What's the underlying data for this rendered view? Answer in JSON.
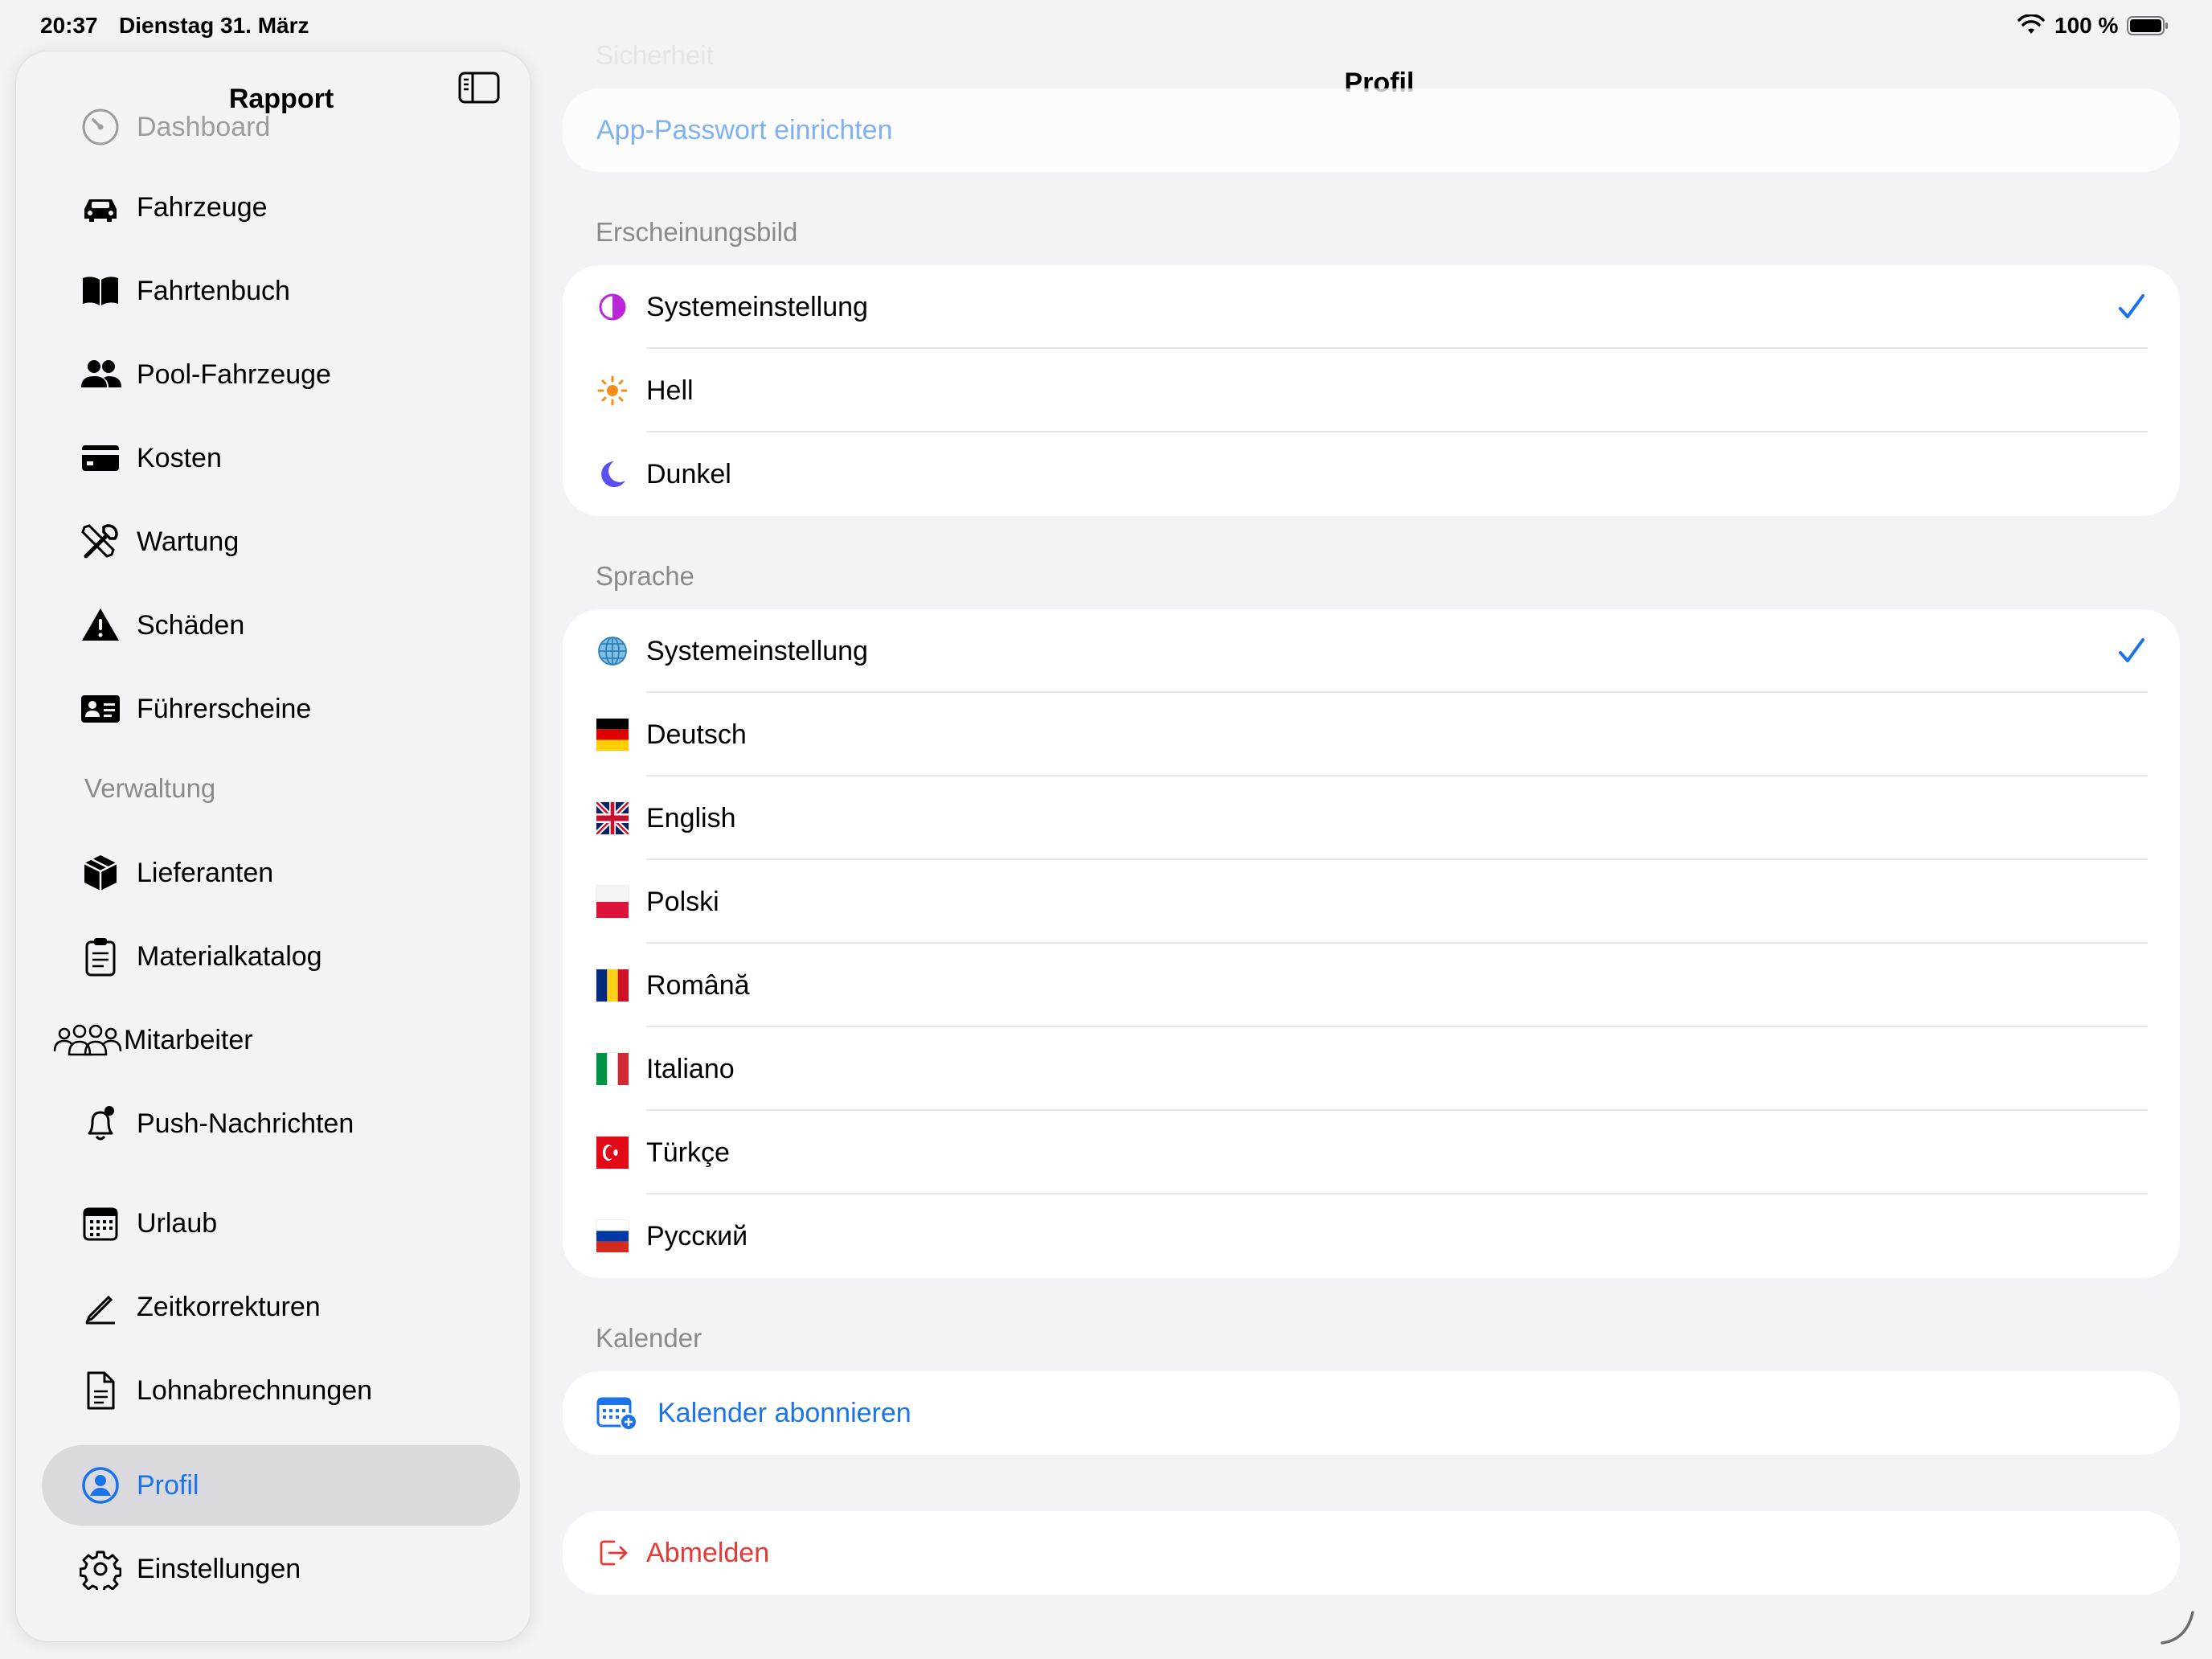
{
  "status_bar": {
    "time": "20:37",
    "date": "Dienstag 31. März",
    "battery": "100 %"
  },
  "sidebar": {
    "title": "Rapport",
    "items": [
      {
        "label": "Dashboard",
        "icon": "gauge-icon"
      },
      {
        "label": "Fahrzeuge",
        "icon": "car-icon"
      },
      {
        "label": "Fahrtenbuch",
        "icon": "book-icon"
      },
      {
        "label": "Pool-Fahrzeuge",
        "icon": "people-icon"
      },
      {
        "label": "Kosten",
        "icon": "credit-card-icon"
      },
      {
        "label": "Wartung",
        "icon": "wrench-screwdriver-icon"
      },
      {
        "label": "Schäden",
        "icon": "warning-icon"
      },
      {
        "label": "Führerscheine",
        "icon": "id-card-icon"
      }
    ],
    "section_label": "Verwaltung",
    "admin_items": [
      {
        "label": "Lieferanten",
        "icon": "shipping-box-icon"
      },
      {
        "label": "Materialkatalog",
        "icon": "clipboard-icon"
      },
      {
        "label": "Mitarbeiter",
        "icon": "group-icon"
      },
      {
        "label": "Push-Nachrichten",
        "icon": "bell-icon"
      },
      {
        "label": "Urlaub",
        "icon": "calendar-icon"
      },
      {
        "label": "Zeitkorrekturen",
        "icon": "pencil-icon"
      },
      {
        "label": "Lohnabrechnungen",
        "icon": "document-icon"
      },
      {
        "label": "Profil",
        "icon": "person-circle-icon"
      },
      {
        "label": "Einstellungen",
        "icon": "gear-icon"
      }
    ]
  },
  "main": {
    "title": "Profil",
    "security": {
      "header": "Sicherheit",
      "app_password": "App-Passwort einrichten"
    },
    "appearance": {
      "header": "Erscheinungsbild",
      "options": [
        {
          "label": "Systemeinstellung",
          "selected": true,
          "icon": "half-circle-icon"
        },
        {
          "label": "Hell",
          "selected": false,
          "icon": "sun-icon"
        },
        {
          "label": "Dunkel",
          "selected": false,
          "icon": "moon-icon"
        }
      ]
    },
    "language": {
      "header": "Sprache",
      "options": [
        {
          "label": "Systemeinstellung",
          "selected": true,
          "icon": "globe-icon"
        },
        {
          "label": "Deutsch",
          "selected": false,
          "icon": "flag-de-icon"
        },
        {
          "label": "English",
          "selected": false,
          "icon": "flag-gb-icon"
        },
        {
          "label": "Polski",
          "selected": false,
          "icon": "flag-pl-icon"
        },
        {
          "label": "Română",
          "selected": false,
          "icon": "flag-ro-icon"
        },
        {
          "label": "Italiano",
          "selected": false,
          "icon": "flag-it-icon"
        },
        {
          "label": "Türkçe",
          "selected": false,
          "icon": "flag-tr-icon"
        },
        {
          "label": "Русский",
          "selected": false,
          "icon": "flag-ru-icon"
        }
      ]
    },
    "calendar": {
      "header": "Kalender",
      "subscribe": "Kalender abonnieren"
    },
    "logout": "Abmelden",
    "colors": {
      "accent": "#1a73e8",
      "destructive": "#e53935",
      "secondary_text": "#8a8a8e"
    }
  }
}
